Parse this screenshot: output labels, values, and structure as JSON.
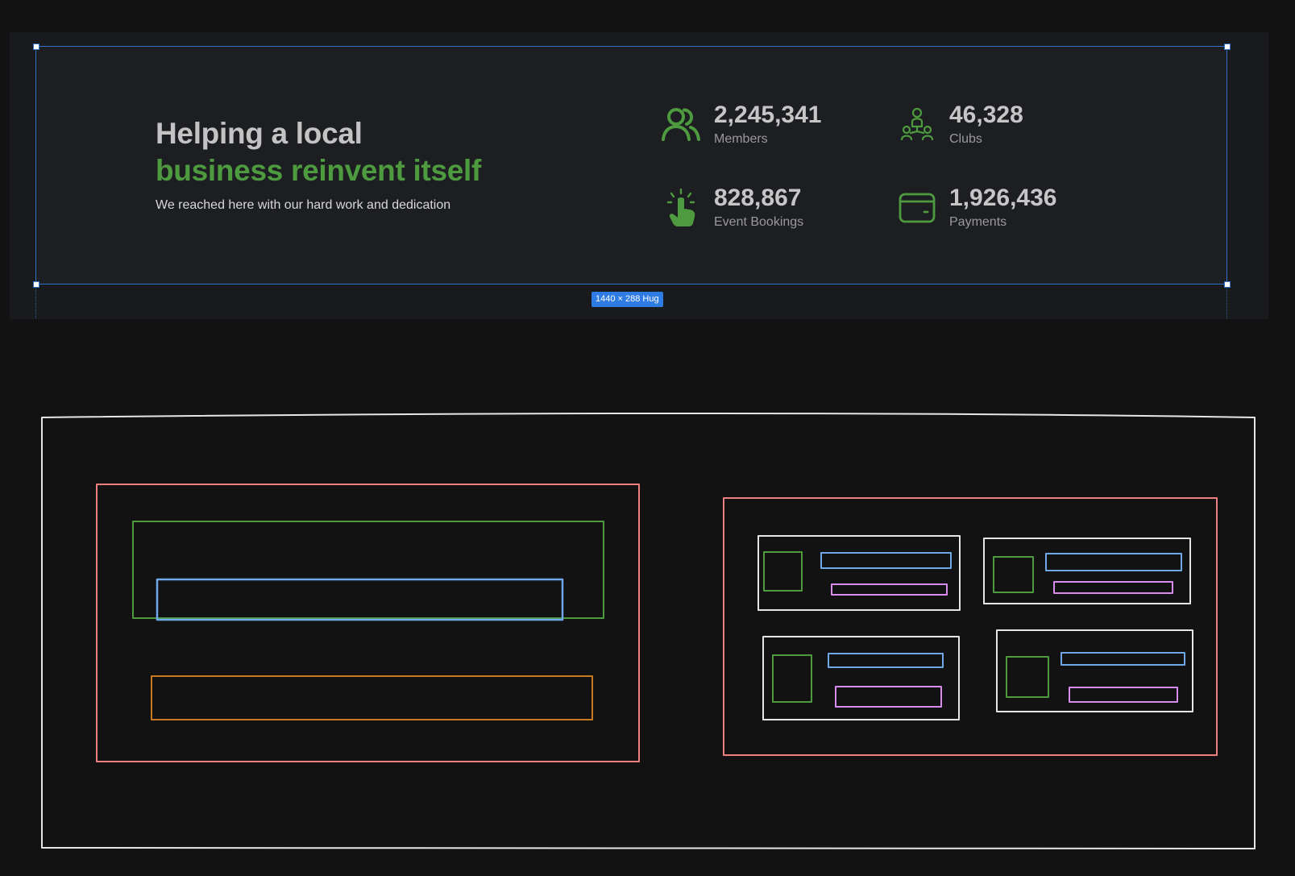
{
  "canvas": {
    "background": "#121212",
    "frame_background": "#1c1e22",
    "selection_color": "#2f73c7"
  },
  "selection": {
    "dimensions_label": "1440 × 288 Hug"
  },
  "hero": {
    "headline_line1": "Helping a local",
    "headline_line2": "business reinvent itself",
    "subtitle": "We reached here with our hard work and dedication",
    "headline_color": "#c3c3c3",
    "accent_color": "#4e9a3f"
  },
  "stats": [
    {
      "value": "2,245,341",
      "label": "Members",
      "icon": "members-icon"
    },
    {
      "value": "46,328",
      "label": "Clubs",
      "icon": "clubs-icon"
    },
    {
      "value": "828,867",
      "label": "Event Bookings",
      "icon": "tap-icon"
    },
    {
      "value": "1,926,436",
      "label": "Payments",
      "icon": "card-icon"
    }
  ],
  "wireframe": {
    "colors": {
      "outer": "#e6e6e6",
      "section": "#f08080",
      "icon_box": "#4e9a3f",
      "text_box": "#6fa8e8",
      "label_box": "#d98cf0",
      "button_box": "#c87a1e",
      "card": "#e6e6e6"
    }
  }
}
